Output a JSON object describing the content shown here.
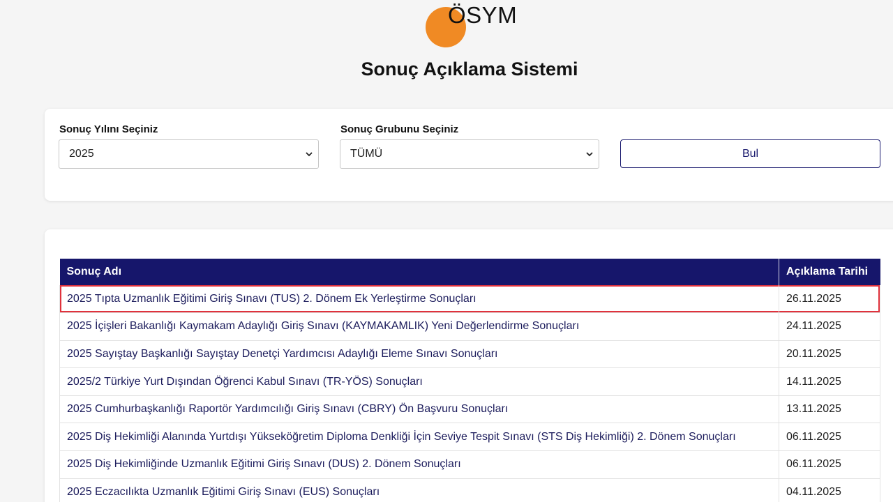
{
  "header": {
    "logo_text": "ÖSYM",
    "title": "Sonuç Açıklama Sistemi",
    "brand_color": "#f08a24"
  },
  "filters": {
    "year_label": "Sonuç Yılını Seçiniz",
    "year_value": "2025",
    "group_label": "Sonuç Grubunu Seçiniz",
    "group_value": "TÜMÜ",
    "find_button": "Bul"
  },
  "table": {
    "columns": [
      "Sonuç Adı",
      "Açıklama Tarihi"
    ],
    "header_color": "#16166b",
    "highlight_color": "#e0323c",
    "rows": [
      {
        "name": "2025 Tıpta Uzmanlık Eğitimi Giriş Sınavı (TUS) 2. Dönem Ek Yerleştirme Sonuçları",
        "date": "26.11.2025",
        "highlighted": true
      },
      {
        "name": "2025 İçişleri Bakanlığı Kaymakam Adaylığı Giriş Sınavı (KAYMAKAMLIK) Yeni Değerlendirme Sonuçları",
        "date": "24.11.2025"
      },
      {
        "name": "2025 Sayıştay Başkanlığı Sayıştay Denetçi Yardımcısı Adaylığı Eleme Sınavı Sonuçları",
        "date": "20.11.2025"
      },
      {
        "name": "2025/2 Türkiye Yurt Dışından Öğrenci Kabul Sınavı (TR-YÖS) Sonuçları",
        "date": "14.11.2025"
      },
      {
        "name": "2025 Cumhurbaşkanlığı Raportör Yardımcılığı Giriş Sınavı (CBRY) Ön Başvuru Sonuçları",
        "date": "13.11.2025"
      },
      {
        "name": "2025 Diş Hekimliği Alanında Yurtdışı Yükseköğretim Diploma Denkliği İçin Seviye Tespit Sınavı (STS Diş Hekimliği) 2. Dönem Sonuçları",
        "date": "06.11.2025"
      },
      {
        "name": "2025 Diş Hekimliğinde Uzmanlık Eğitimi Giriş Sınavı (DUS) 2. Dönem Sonuçları",
        "date": "06.11.2025"
      },
      {
        "name": "2025 Eczacılıkta Uzmanlık Eğitimi Giriş Sınavı (EUS) Sonuçları",
        "date": "04.11.2025"
      }
    ]
  }
}
